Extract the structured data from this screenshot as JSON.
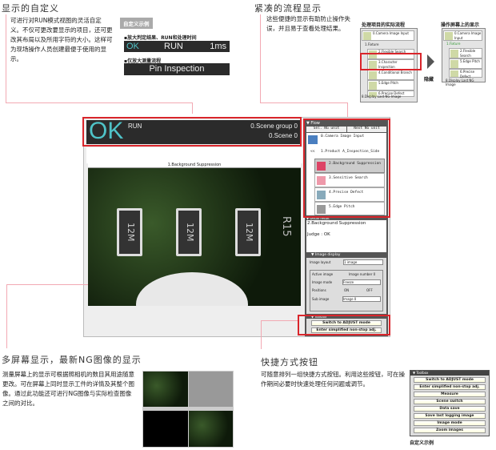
{
  "custom_display": {
    "title": "显示的自定义",
    "body": "可进行对RUN模式视图的灵活自定义。不仅可更改要显示的项目，还可更改其布局以及所用字符的大小。这样可为现场操作人员创建最便于使用的显示。",
    "example_badge": "自定义示例",
    "example1_caption": "▪放大判定结果、RUN和处理时间",
    "example1": {
      "judge": "OK",
      "mode": "RUN",
      "time": "1ms"
    },
    "example2_caption": "▪仅放大测量流程",
    "example2": {
      "text": "Pin Inspection"
    }
  },
  "compact_flow": {
    "title": "紧凑的流程显示",
    "body": "这些便捷的显示有助防止操作失误，并且易于查看处理结果。",
    "actual_label": "处理项目的实际流程",
    "screen_label": "操作屏幕上的显示",
    "hide_label": "隐藏",
    "actual_items": [
      "0.Camera Image Input",
      "1.Fixture",
      "2.Flexible Search",
      "3.Character Inspection",
      "4.Conditional Branch",
      "5.Edge Pitch",
      "6.Precise Defect",
      "8.Display Last NG Image"
    ],
    "screen_items": [
      "0.Camera Image Input",
      "1.Fixture",
      "2.Flexible Search",
      "5.Edge Pitch",
      "6.Precise Defect",
      "8.Display Last NG Image"
    ]
  },
  "main_screen": {
    "judge": "OK",
    "mode": "RUN",
    "scene_group": "0.Scene group 0",
    "scene": "0.Scene 0",
    "image_title": "1.Background Suppression",
    "chip_labels": [
      "12M",
      "12M",
      "12M",
      "R15"
    ],
    "flow_panel": {
      "header": "▼ Flow",
      "prev_button": "Sel. NG unit",
      "next_button": "Next NG unit",
      "items": [
        "0.Camera Image Input",
        "1.Product A_Inspection_Side",
        "2.Background Suppression",
        "3.Sensitive Search",
        "4.Precise Defect",
        "5.Edge Pitch"
      ],
      "item_index_prefix": "<<"
    },
    "result_panel": {
      "header": "▼ Detail result",
      "unit": "2.Background Suppression",
      "judge": "Judge : OK"
    },
    "image_display": {
      "header": "▼ Image display",
      "layout_label": "Image layout",
      "layout_value": "1 image",
      "active_image_label": "Active image",
      "active_image_value": "Image number 0",
      "image_mode_label": "Image mode",
      "image_mode_value": "Freeze",
      "position_label": "Positions",
      "on_label": "ON",
      "off_label": "OFF",
      "sub_image_label": "Sub image",
      "sub_image_value": "Image 0"
    },
    "toolbox": {
      "header": "▼ Toolbox",
      "buttons": [
        "Switch to ADJUST mode",
        "Enter simplified non-stop adj."
      ]
    }
  },
  "multi_screen": {
    "title": "多屏幕显示，最新NG图像的显示",
    "body": "测量屏幕上的显示可根据照相机的数目其用途随意更改。可在屏幕上同时显示工件的详情及其整个图像。通过此功能还可进行NG图像与实际检查图像之间的对比。"
  },
  "shortcut": {
    "title": "快捷方式按钮",
    "body": "可随意排列一组快捷方式按钮。利用这些按钮，可在操作期间必要时快速处理任何问题或调节。",
    "panel_header": "▼ Toolbox",
    "buttons": [
      "Switch to ADJUST mode",
      "Enter simplified non-stop adj.",
      "Measure",
      "Scene switch",
      "Data save",
      "Save last logging image",
      "Image mode",
      "Zoom images"
    ],
    "caption": "自定义示例"
  },
  "colors": {
    "accent_pink": "#f2a9b3",
    "highlight_red": "#d9252b",
    "ok_cyan": "#4fc3c8",
    "bar_dark": "#2b2b2b"
  }
}
